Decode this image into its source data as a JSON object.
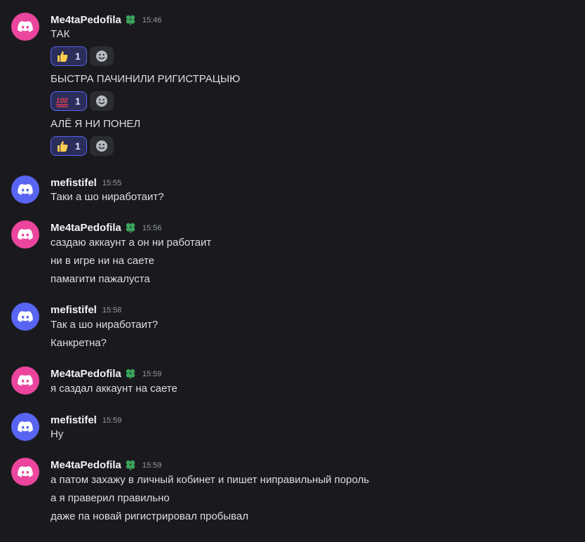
{
  "colors": {
    "background": "#1a1a1e",
    "avatar_pink": "#eb459e",
    "avatar_blue": "#5865f2",
    "reaction_border": "#5865f2",
    "reaction_bg": "#2b2d5a",
    "badge_green": "#3ba55c"
  },
  "messages": [
    {
      "username": "Me4taPedofila",
      "badge_icon": "clover-badge-icon",
      "time": "15:46",
      "lines": [
        "ТАК",
        "БЫСТРА ПАЧИНИЛИ РИГИСТРАЦЫЮ",
        "АЛЁ Я НИ ПОНЕЛ"
      ],
      "reactions": [
        {
          "emoji_icon": "thumbs-up-icon",
          "count": "1"
        },
        {
          "emoji_icon": "hundred-points-icon",
          "count": "1"
        },
        {
          "emoji_icon": "thumbs-up-icon",
          "count": "1"
        }
      ]
    },
    {
      "username": "mefistifel",
      "time": "15:55",
      "lines": [
        "Таки а шо ниработаит?"
      ]
    },
    {
      "username": "Me4taPedofila",
      "badge_icon": "clover-badge-icon",
      "time": "15:56",
      "lines": [
        "саздаю аккаунт а он ни работаит",
        "ни в игре ни на саете",
        "памагити пажалуста"
      ]
    },
    {
      "username": "mefistifel",
      "time": "15:58",
      "lines": [
        "Так а шо ниработаит?",
        "Канкретна?"
      ]
    },
    {
      "username": "Me4taPedofila",
      "badge_icon": "clover-badge-icon",
      "time": "15:59",
      "lines": [
        "я саздал аккаунт на саете"
      ]
    },
    {
      "username": "mefistifel",
      "time": "15:59",
      "lines": [
        "Ну"
      ]
    },
    {
      "username": "Me4taPedofila",
      "badge_icon": "clover-badge-icon",
      "time": "15:59",
      "lines": [
        "а патом захажу в личный кобинет и пишет ниправильный пороль",
        "а я праверил правильно",
        "даже па новай ригистрировал пробывал"
      ]
    }
  ]
}
